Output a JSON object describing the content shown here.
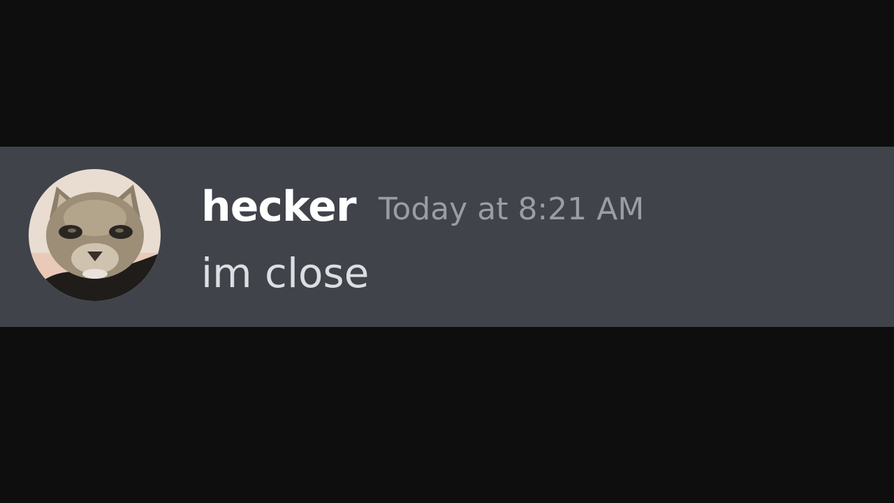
{
  "message": {
    "author": "hecker",
    "timestamp": "Today at 8:21 AM",
    "content": "im close",
    "avatar_icon": "cat-avatar-icon"
  },
  "colors": {
    "background": "#0e0e0f",
    "row_highlight": "#40434a",
    "username": "#ffffff",
    "timestamp": "#9b9da3",
    "content": "#dcdee1"
  }
}
